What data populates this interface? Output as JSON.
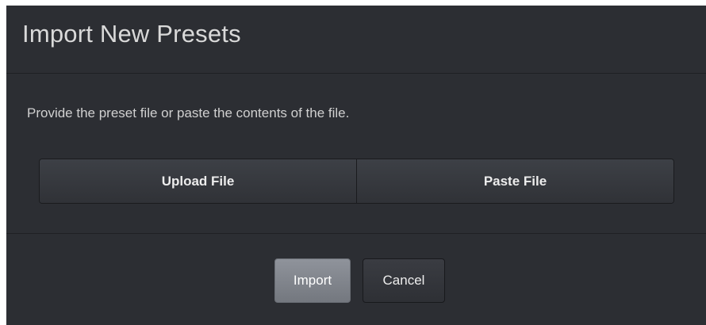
{
  "dialog": {
    "title": "Import New Presets",
    "description": "Provide the preset file or paste the contents of the file.",
    "options": {
      "upload_label": "Upload File",
      "paste_label": "Paste File"
    },
    "footer": {
      "import_label": "Import",
      "cancel_label": "Cancel"
    }
  }
}
